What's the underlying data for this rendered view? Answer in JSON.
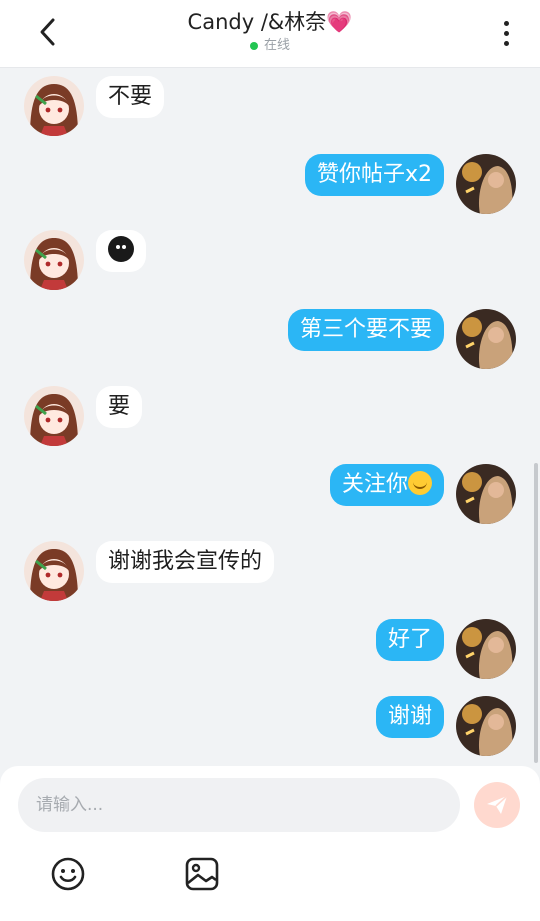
{
  "header": {
    "title": "Candy /&林奈",
    "title_heart": "💗",
    "status_text": "在线",
    "status_color": "#23c552",
    "back_icon": "chevron-left-icon",
    "more_icon": "more-vertical-icon"
  },
  "colors": {
    "outgoing_bubble": "#2bb6f5",
    "incoming_bubble": "#ffffff",
    "background": "#f1f3f5",
    "send_button": "#ffd9cf"
  },
  "messages": [
    {
      "side": "left",
      "text": "不要"
    },
    {
      "side": "right",
      "text": "赞你帖子x2"
    },
    {
      "side": "left",
      "text": "",
      "emoji": "black-face-emoji"
    },
    {
      "side": "right",
      "text": "第三个要不要"
    },
    {
      "side": "left",
      "text": "要"
    },
    {
      "side": "right",
      "text": "关注你",
      "emoji": "smiling-face-emoji"
    },
    {
      "side": "left",
      "text": "谢谢我会宣传的"
    },
    {
      "side": "right",
      "text": "好了"
    },
    {
      "side": "right",
      "text": "谢谢"
    }
  ],
  "composer": {
    "placeholder": "请输入...",
    "value": "",
    "send_icon": "paper-plane-icon",
    "emoji_tool_icon": "smiley-icon",
    "image_tool_icon": "image-icon"
  }
}
